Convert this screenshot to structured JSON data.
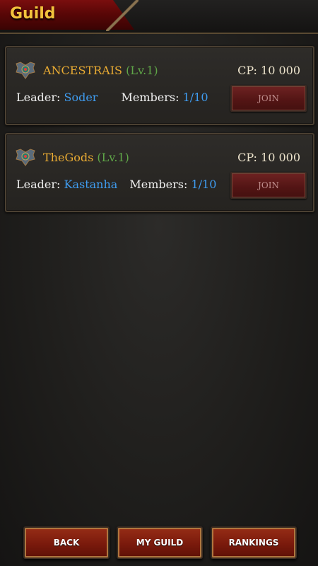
{
  "header": {
    "title": "Guild"
  },
  "guilds": [
    {
      "name": "ANCESTRAIS",
      "level": "(Lv.1)",
      "cp": "CP: 10 000",
      "leader_label": "Leader:",
      "leader": "Soder",
      "members_label": "Members:",
      "members": "1/10",
      "join_label": "JOIN"
    },
    {
      "name": "TheGods",
      "level": "(Lv.1)",
      "cp": "CP: 10 000",
      "leader_label": "Leader:",
      "leader": "Kastanha",
      "members_label": "Members:",
      "members": "1/10",
      "join_label": "JOIN"
    }
  ],
  "footer": {
    "back_label": "BACK",
    "my_guild_label": "MY GUILD",
    "rankings_label": "RANKINGS"
  },
  "colors": {
    "accent_gold": "#e9ab33",
    "level_green": "#5fa548",
    "value_blue": "#3f9cf0",
    "button_red": "#7a1a0c"
  },
  "icons": {
    "guild_emblem": "guild-emblem-icon"
  }
}
